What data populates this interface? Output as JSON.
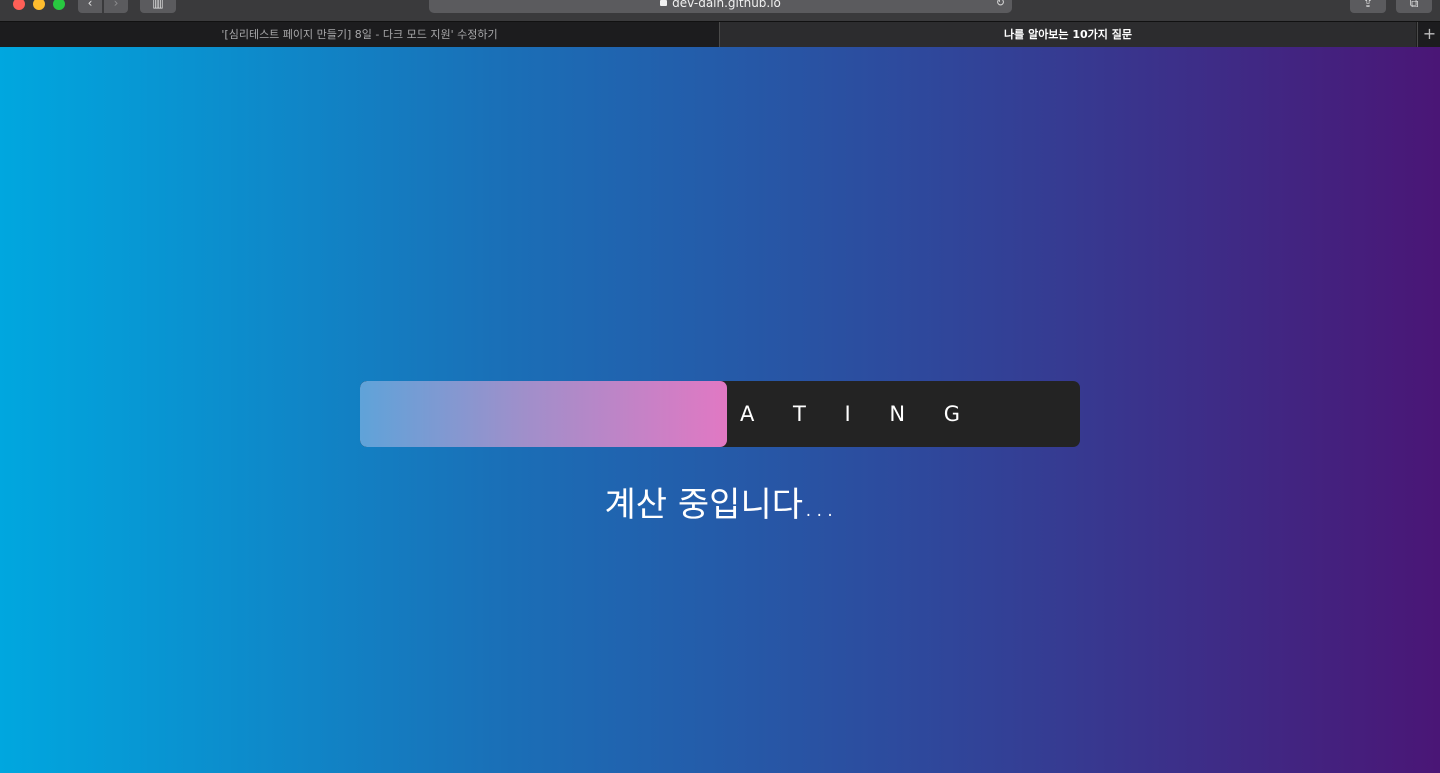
{
  "browser": {
    "url": "dev-dain.github.io",
    "back_icon": "chevron-left-icon",
    "forward_icon": "chevron-right-icon",
    "tabs": [
      {
        "label": "'[심리테스트 페이지 만들기] 8일 - 다크 모드 지원' 수정하기",
        "active": false
      },
      {
        "label": "나를 알아보는 10가지 질문",
        "active": true
      }
    ],
    "new_tab_label": "+"
  },
  "loader": {
    "progress_fraction": 0.51,
    "label": "A T I N G",
    "status": "계산 중입니다...",
    "colors": {
      "track": "#232323",
      "fill_start": "#5fa3d9",
      "fill_end": "#e178c3"
    }
  },
  "page_colors": {
    "gradient_start": "#00a7df",
    "gradient_end": "#4a1676"
  }
}
